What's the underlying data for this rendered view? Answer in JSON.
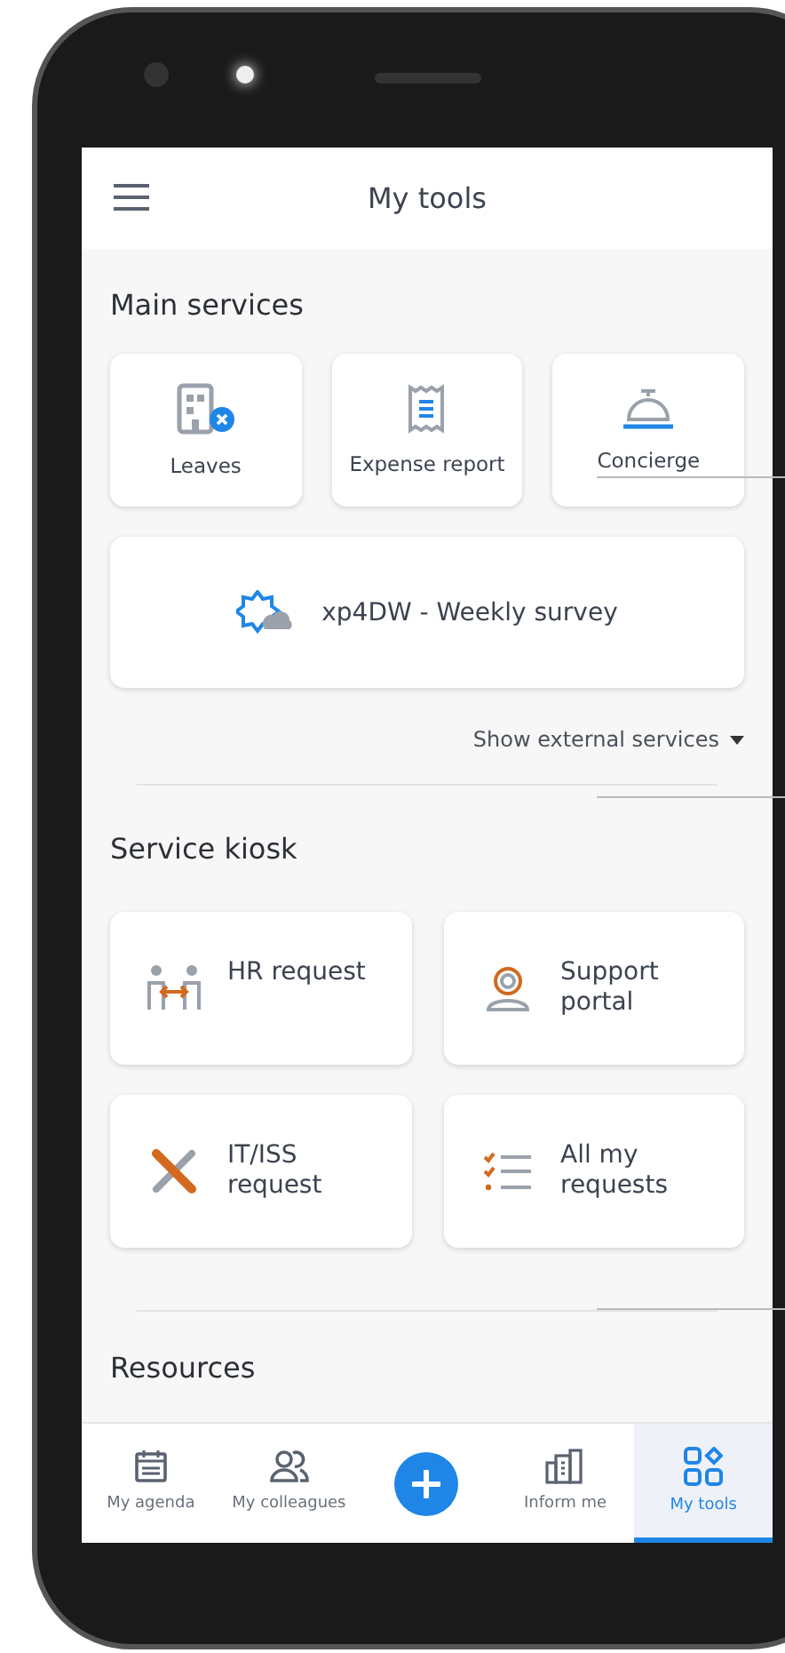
{
  "header": {
    "title": "My tools"
  },
  "main_services": {
    "title": "Main services",
    "tiles": [
      {
        "label": "Leaves"
      },
      {
        "label": "Expense report"
      },
      {
        "label": "Concierge"
      }
    ],
    "survey": {
      "label": "xp4DW - Weekly survey"
    },
    "expand_link": {
      "label": "Show external services",
      "expanded": false
    }
  },
  "service_kiosk": {
    "title": "Service kiosk",
    "tiles": [
      {
        "label": "HR request"
      },
      {
        "label": "Support portal"
      },
      {
        "label": "IT/ISS request"
      },
      {
        "label": "All my requests"
      }
    ]
  },
  "resources": {
    "title": "Resources"
  },
  "bottom_nav": [
    {
      "kind": "tab",
      "label": "My agenda",
      "selected": false
    },
    {
      "kind": "tab",
      "label": "My colleagues",
      "selected": false
    },
    {
      "kind": "action"
    },
    {
      "kind": "tab",
      "label": "Inform me",
      "selected": false
    },
    {
      "kind": "tab",
      "label": "My tools",
      "selected": true
    }
  ]
}
